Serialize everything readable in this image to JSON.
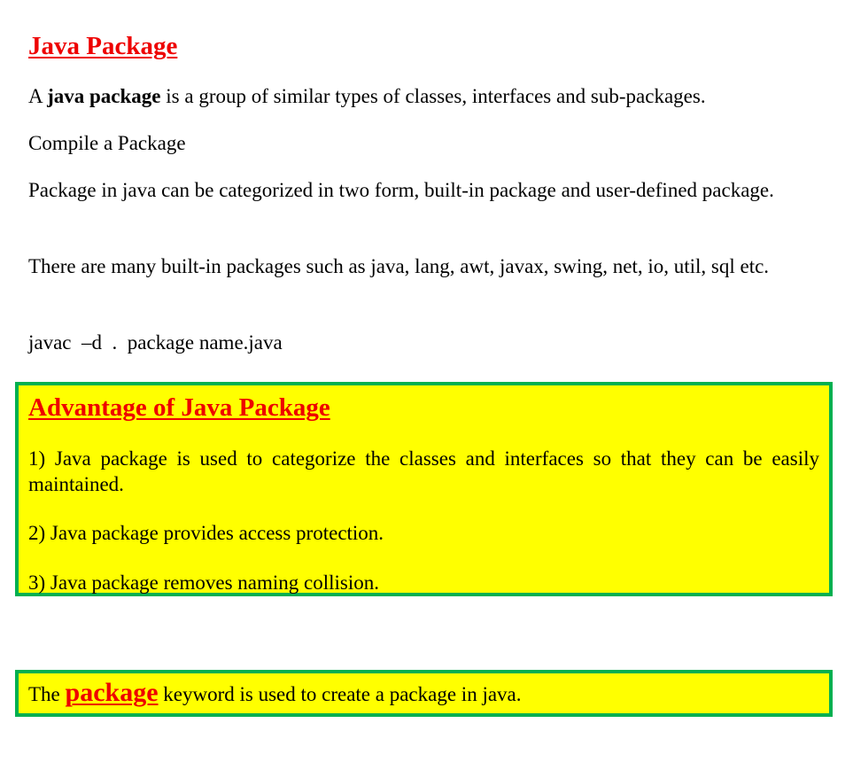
{
  "title": "Java Package",
  "intro": {
    "prefix": "A ",
    "bold": "java package",
    "suffix": " is a group of similar types of classes, interfaces and sub-packages."
  },
  "compile_heading": "Compile a Package",
  "categories_text": "Package in java can be categorized in two form, built-in package and user-defined package.",
  "builtin_text": "There are many built-in packages such as java, lang, awt, javax, swing, net, io, util, sql etc.",
  "command": {
    "javac": "javac",
    "flag": "–d",
    "dot": ".",
    "target": "package name.java"
  },
  "advantages": {
    "heading": "Advantage of Java Package",
    "items": [
      "1) Java package is used to categorize the classes and interfaces so that they can be easily maintained.",
      "2) Java package provides access protection.",
      "3) Java package removes naming collision."
    ]
  },
  "keyword_note": {
    "prefix": "The ",
    "keyword": "package",
    "suffix": " keyword is used to create a package in java."
  },
  "colors": {
    "heading": "#ee0000",
    "box_fill": "#ffff00",
    "box_border": "#00b050"
  }
}
